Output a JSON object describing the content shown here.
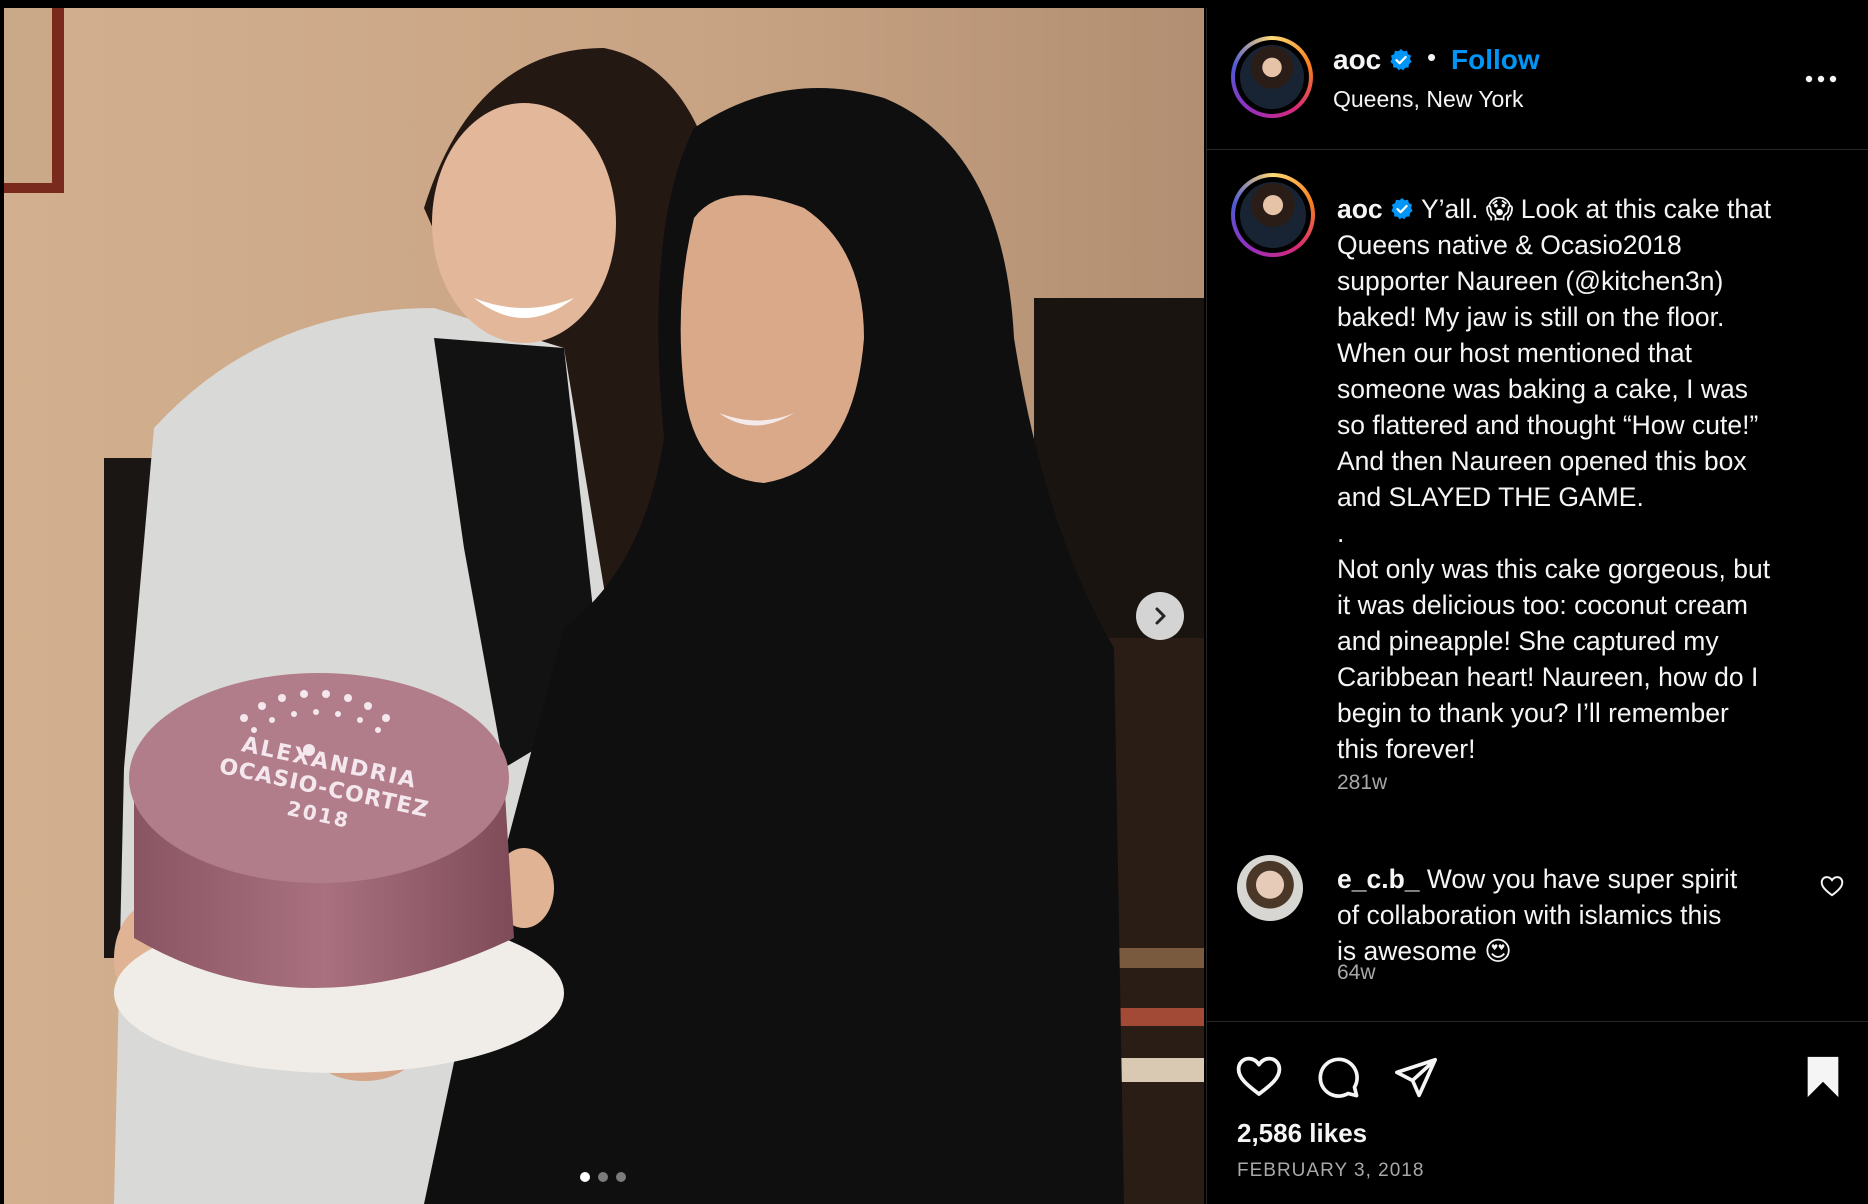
{
  "post": {
    "media_count": 3,
    "media_active_index": 0,
    "cake_text": [
      "ALEXANDRIA",
      "OCASIO-CORTEZ",
      "2018"
    ]
  },
  "header": {
    "username": "aoc",
    "verified": true,
    "separator": "•",
    "follow_label": "Follow",
    "location": "Queens, New York"
  },
  "caption": {
    "username": "aoc",
    "lines": [
      "Y’all. 😱 Look at this cake that",
      "Queens native & Ocasio2018",
      "supporter Naureen (@kitchen3n)",
      "baked! My jaw is still on the floor.",
      "When our host mentioned that",
      "someone was baking a cake, I was",
      "so flattered and thought “How cute!”",
      "And then Naureen opened this box",
      "and SLAYED THE GAME.",
      ".",
      "Not only was this cake gorgeous, but",
      "it was delicious too: coconut cream",
      "and pineapple! She captured my",
      "Caribbean heart! Naureen, how do I",
      "begin to thank you? I’ll remember",
      "this forever!"
    ],
    "time": "281w"
  },
  "comment": {
    "username": "e_c.b_",
    "lines": [
      "Wow you have super spirit",
      "of collaboration with islamics this",
      "is awesome 😍"
    ],
    "time": "64w"
  },
  "actions": {
    "likes": "2,586 likes",
    "date": "FEBRUARY 3, 2018"
  },
  "icons": {
    "verified": "verified-badge-icon",
    "more": "more-options-icon",
    "next": "chevron-right-icon",
    "like": "heart-icon",
    "comment": "comment-bubble-icon",
    "share": "paper-plane-icon",
    "save": "bookmark-icon"
  },
  "colors": {
    "accent": "#0095f6",
    "background": "#000000",
    "text": "#f5f5f5",
    "muted": "#a8a8a8",
    "cake": "#9a6674"
  }
}
